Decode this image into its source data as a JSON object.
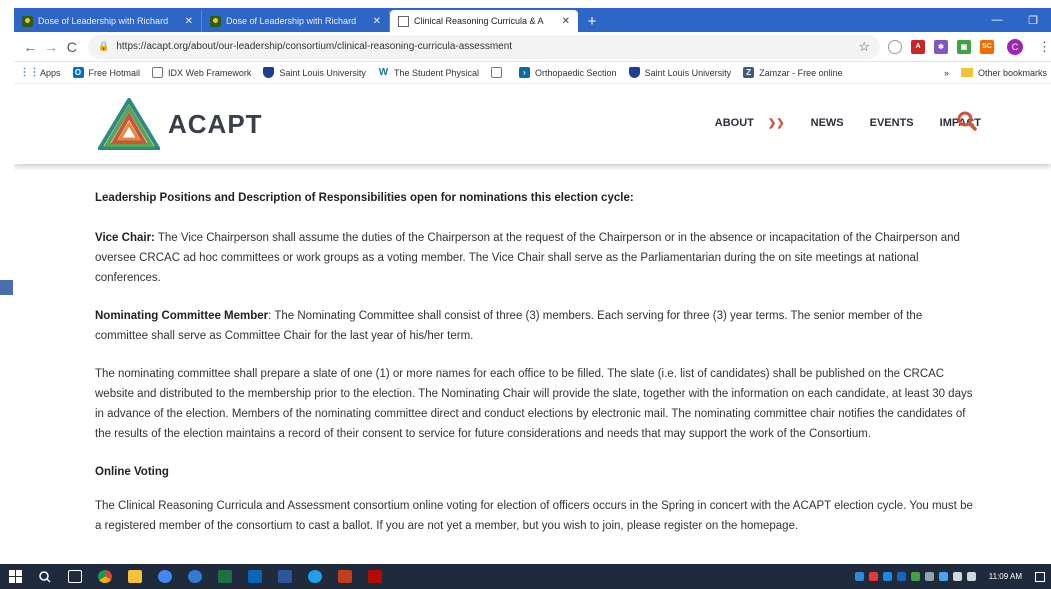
{
  "browser": {
    "tabs": [
      {
        "title": "Dose of Leadership with Richard",
        "active": false
      },
      {
        "title": "Dose of Leadership with Richard",
        "active": false
      },
      {
        "title": "Clinical Reasoning Curricula & A",
        "active": true
      }
    ],
    "url": "https://acapt.org/about/our-leadership/consortium/clinical-reasoning-curricula-assessment",
    "profile_initial": "C",
    "bookmarks": [
      {
        "label": "Apps",
        "icon": "apps-grid-icon",
        "color": "#4285f4"
      },
      {
        "label": "Free Hotmail",
        "icon": "outlook-icon",
        "color": "#0072c6"
      },
      {
        "label": "IDX Web Framework",
        "icon": "page-icon",
        "color": "#ffffff"
      },
      {
        "label": "Saint Louis University",
        "icon": "shield-icon",
        "color": "#1c3f94"
      },
      {
        "label": "The Student Physical",
        "icon": "wp-icon",
        "color": "#21759b"
      },
      {
        "label": "",
        "icon": "page-icon",
        "color": "#ffffff"
      },
      {
        "label": "Orthopaedic Section",
        "icon": "arrow-icon",
        "color": "#0a6aa1"
      },
      {
        "label": "Saint Louis University",
        "icon": "shield-icon",
        "color": "#1c3f94"
      },
      {
        "label": "Zamzar - Free online",
        "icon": "zamzar-icon",
        "color": "#3d5a80"
      }
    ],
    "bookmarks_overflow": "»",
    "other_bookmarks": "Other bookmarks"
  },
  "site": {
    "logo_text": "ACAPT",
    "nav": {
      "about": "ABOUT",
      "news": "NEWS",
      "events": "EVENTS",
      "impact": "IMPACT"
    },
    "brand_colors": {
      "accent": "#c9553a",
      "teal": "#2e8b84",
      "green": "#5aa454"
    }
  },
  "content": {
    "heading": "Leadership Positions and Description of Responsibilities open for nominations this election cycle:",
    "vice_chair_label": "Vice Chair:",
    "vice_chair_text": " The Vice Chairperson shall assume the duties of the Chairperson at the request of the Chairperson or in the absence or incapacitation of the Chairperson and oversee CRCAC ad hoc committees or work groups as a voting member.  The Vice Chair shall serve as the Parliamentarian during the on site meetings at national conferences.",
    "nominating_label": "Nominating Committee Member",
    "nominating_text": ": The Nominating Committee shall consist of three (3) members.  Each serving for three (3) year terms.  The senior member of the committee shall serve as Committee Chair for the last year of his/her term.",
    "committee_paragraph": "The nominating committee shall prepare a slate of one (1) or more names for each office to be filled.  The slate (i.e. list of candidates) shall be published on the CRCAC website and distributed to the membership prior to the election.  The Nominating Chair will provide the slate, together with the information on each candidate, at least 30 days in advance of the election.  Members of the nominating committee direct and conduct elections by electronic mail.  The nominating committee chair notifies the candidates of the results of the election maintains a record of their consent to service for future considerations and needs that may support the work of the Consortium.",
    "online_voting_heading": "Online Voting",
    "online_voting_text": "The Clinical Reasoning Curricula and Assessment consortium online voting for election of officers occurs in the Spring in concert with the ACAPT election cycle. You must be a registered member of the consortium to cast a ballot.  If you are not yet a member, but you wish to join, please register on the homepage."
  },
  "taskbar": {
    "clock": "11:09 AM"
  }
}
